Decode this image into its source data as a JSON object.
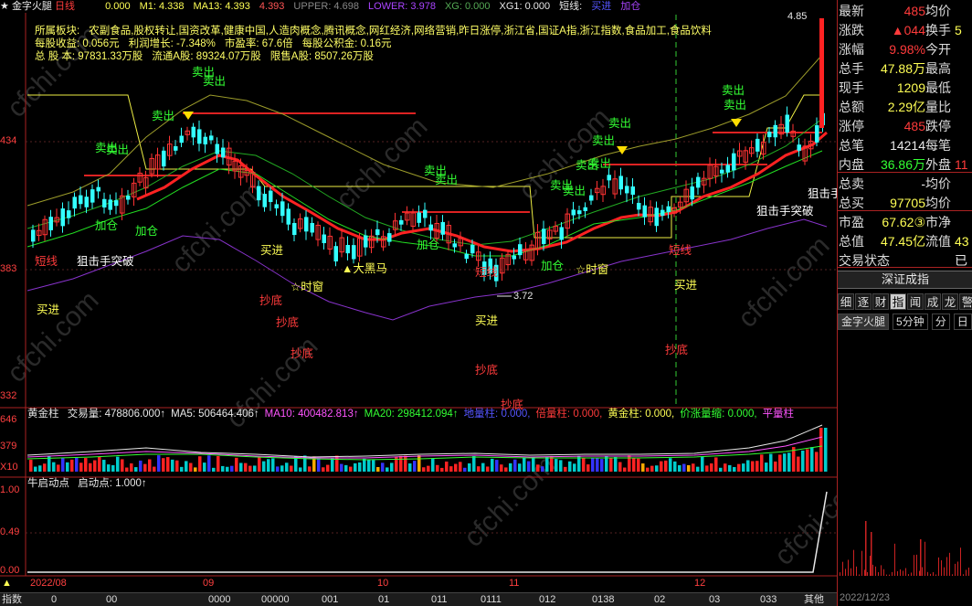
{
  "header": {
    "title": "金字火腿",
    "period": "日线",
    "indicators": [
      {
        "label": "0.000",
        "color": "#ffff55"
      },
      {
        "label": "M1: 4.338",
        "color": "#ffff55"
      },
      {
        "label": "MA13: 4.393",
        "color": "#ffff55"
      },
      {
        "label": "4.393",
        "color": "#ff5555"
      },
      {
        "label": "UPPER: 4.698",
        "color": "#888888"
      },
      {
        "label": "LOWER: 3.978",
        "color": "#aa44ff"
      },
      {
        "label": "XG: 0.000",
        "color": "#55aa55"
      },
      {
        "label": "XG1: 0.000",
        "color": "#e8e8e8"
      },
      {
        "label": "短线:",
        "color": "#e8e8e8"
      },
      {
        "label": "买进",
        "color": "#5555ff"
      },
      {
        "label": "加仓",
        "color": "#aa44ff"
      }
    ]
  },
  "info": {
    "line1_label": "所属板块:",
    "line1_value": "农副食品,股权转让,国资改革,健康中国,人造肉概念,腾讯概念,网红经济,网络营销,昨日涨停,浙江省,国证A指,浙江指数,食品加工,食品饮料",
    "line2": [
      "每股收益: 0.056元",
      "利润增长: -7.348%",
      "市盈率: 67.6倍",
      "每股公积金: 0.16元"
    ],
    "line3": [
      "总 股 本: 97831.33万股",
      "流通A股: 89324.07万股",
      "限售A股: 8507.26万股"
    ]
  },
  "price_axis": [
    "434",
    "383",
    "332"
  ],
  "price_annotations": {
    "high": "4.85",
    "low": "3.72"
  },
  "signals": [
    {
      "text": "卖出",
      "color": "#33ff33",
      "cls": "s1"
    },
    {
      "text": "卖出",
      "color": "#33ff33",
      "cls": "s2"
    },
    {
      "text": "卖出",
      "color": "#33ff33",
      "cls": "s3"
    },
    {
      "text": "卖出",
      "color": "#33ff33",
      "cls": "s4"
    },
    {
      "text": "卖出",
      "color": "#33ff33",
      "cls": "s5"
    },
    {
      "text": "卖出",
      "color": "#33ff33",
      "cls": "s6"
    },
    {
      "text": "卖出",
      "color": "#33ff33",
      "cls": "s7"
    },
    {
      "text": "卖出",
      "color": "#33ff33",
      "cls": "s8"
    },
    {
      "text": "卖出",
      "color": "#33ff33",
      "cls": "s9"
    },
    {
      "text": "卖出",
      "color": "#33ff33",
      "cls": "s10"
    },
    {
      "text": "卖出",
      "color": "#33ff33",
      "cls": "s11"
    },
    {
      "text": "卖出",
      "color": "#33ff33",
      "cls": "s12"
    },
    {
      "text": "卖出",
      "color": "#33ff33",
      "cls": "s13"
    },
    {
      "text": "加仓",
      "color": "#33ff33",
      "cls": "s14"
    },
    {
      "text": "加仓",
      "color": "#33ff33",
      "cls": "s15"
    },
    {
      "text": "加仓",
      "color": "#33ff33",
      "cls": "s16"
    },
    {
      "text": "加仓",
      "color": "#33ff33",
      "cls": "s17"
    },
    {
      "text": "短线",
      "color": "#ff3b3b",
      "cls": "s18"
    },
    {
      "text": "短线",
      "color": "#ff3b3b",
      "cls": "s19"
    },
    {
      "text": "狙击手突破",
      "color": "#ffffff",
      "cls": "s20"
    },
    {
      "text": "狙击手突破",
      "color": "#ffffff",
      "cls": "s21"
    },
    {
      "text": "狙击手",
      "color": "#ffffff",
      "cls": "s22"
    },
    {
      "text": "买进",
      "color": "#ffff55",
      "cls": "s23"
    },
    {
      "text": "买进",
      "color": "#ffff55",
      "cls": "s24"
    },
    {
      "text": "买进",
      "color": "#ffff55",
      "cls": "s25"
    },
    {
      "text": "买进",
      "color": "#ffff55",
      "cls": "s26"
    },
    {
      "text": "抄底",
      "color": "#ff3b3b",
      "cls": "s27"
    },
    {
      "text": "抄底",
      "color": "#ff3b3b",
      "cls": "s28"
    },
    {
      "text": "抄底",
      "color": "#ff3b3b",
      "cls": "s29"
    },
    {
      "text": "抄底",
      "color": "#ff3b3b",
      "cls": "s30"
    },
    {
      "text": "抄底",
      "color": "#ff3b3b",
      "cls": "s31"
    },
    {
      "text": "抄底",
      "color": "#ff3b3b",
      "cls": "s32"
    },
    {
      "text": "☆时窗",
      "color": "#ffff55",
      "cls": "s33"
    },
    {
      "text": "☆时窗",
      "color": "#ffff55",
      "cls": "s34"
    },
    {
      "text": "▲大黑马",
      "color": "#ffff55",
      "cls": "s35"
    },
    {
      "text": "短线",
      "color": "#ff3b3b",
      "cls": "s36"
    }
  ],
  "volume_panel": {
    "title": "黄金柱",
    "axis": [
      "646",
      "379",
      "X10"
    ],
    "items": [
      {
        "label": "交易量: 478806.000↑",
        "color": "#e8e8e8"
      },
      {
        "label": "MA5: 506464.406↑",
        "color": "#e8e8e8"
      },
      {
        "label": "MA10: 400482.813↑",
        "color": "#ff55ff"
      },
      {
        "label": "MA20: 298412.094↑",
        "color": "#33ff33"
      },
      {
        "label": "地量柱: 0.000,",
        "color": "#5555ff"
      },
      {
        "label": "倍量柱: 0.000,",
        "color": "#ff3b3b"
      },
      {
        "label": "黄金柱: 0.000,",
        "color": "#ffff55"
      },
      {
        "label": "价涨量缩: 0.000,",
        "color": "#33ff33"
      },
      {
        "label": "平量柱",
        "color": "#ff55ff"
      }
    ]
  },
  "start_panel": {
    "title": "牛启动点",
    "value": "启动点: 1.000↑",
    "axis": [
      "1.00",
      "0.49",
      "0.00"
    ]
  },
  "x_axis": [
    "2022/08",
    "09",
    "10",
    "11",
    "12"
  ],
  "quote": {
    "rows": [
      {
        "l1": "最新",
        "v1": "485",
        "c1": "#ff3b3b",
        "l2": "均价",
        "v2": "",
        "c2": "#ff3b3b"
      },
      {
        "l1": "涨跌",
        "v1": "▲044",
        "c1": "#ff3b3b",
        "l2": "换手",
        "v2": "5",
        "c2": "#ffff55"
      },
      {
        "l1": "涨幅",
        "v1": "9.98%",
        "c1": "#ff3b3b",
        "l2": "今开",
        "v2": "",
        "c2": "#ff3b3b"
      },
      {
        "l1": "总手",
        "v1": "47.88万",
        "c1": "#ffff55",
        "l2": "最高",
        "v2": "",
        "c2": "#ff3b3b"
      },
      {
        "l1": "现手",
        "v1": "1209",
        "c1": "#ffff55",
        "l2": "最低",
        "v2": "",
        "c2": "#ff3b3b"
      },
      {
        "l1": "总额",
        "v1": "2.29亿",
        "c1": "#ffff55",
        "l2": "量比",
        "v2": "",
        "c2": "#ffff55"
      },
      {
        "l1": "涨停",
        "v1": "485",
        "c1": "#ff3b3b",
        "l2": "跌停",
        "v2": "",
        "c2": "#33ff33"
      },
      {
        "l1": "总笔",
        "v1": "14214",
        "c1": "#e8e8e8",
        "l2": "每笔",
        "v2": "",
        "c2": "#e8e8e8"
      },
      {
        "l1": "内盘",
        "v1": "36.86万",
        "c1": "#33ff33",
        "l2": "外盘",
        "v2": "11",
        "c2": "#ff3b3b"
      },
      {
        "l1": "总卖",
        "v1": "-",
        "c1": "#e8e8e8",
        "l2": "均价",
        "v2": "",
        "c2": "#e8e8e8"
      },
      {
        "l1": "总买",
        "v1": "97705",
        "c1": "#ffff55",
        "l2": "均价",
        "v2": "",
        "c2": "#e8e8e8"
      },
      {
        "l1": "市盈",
        "v1": "67.62③",
        "c1": "#ffff55",
        "l2": "市净",
        "v2": "",
        "c2": "#e8e8e8"
      },
      {
        "l1": "总值",
        "v1": "47.45亿",
        "c1": "#ffff55",
        "l2": "流值",
        "v2": "43",
        "c2": "#ffff55"
      },
      {
        "l1": "交易状态",
        "v1": "",
        "c1": "#e8e8e8",
        "l2": "",
        "v2": "已",
        "c2": "#e8e8e8"
      }
    ],
    "index_button": "深证成指",
    "tabs": [
      "细",
      "逐",
      "财",
      "指",
      "闻",
      "成",
      "龙",
      "警"
    ],
    "active_tab": "指",
    "min_tabs": [
      "金字火腿",
      "5分钟",
      "分",
      "日",
      "周"
    ],
    "date_label": "2022/12/23"
  },
  "bottom_tabs": [
    "指数",
    "0",
    "00",
    "0000",
    "00000",
    "001",
    "01",
    "011",
    "0111",
    "012",
    "0138",
    "02",
    "03",
    "033",
    "其他"
  ],
  "watermark": "cfchi.com"
}
